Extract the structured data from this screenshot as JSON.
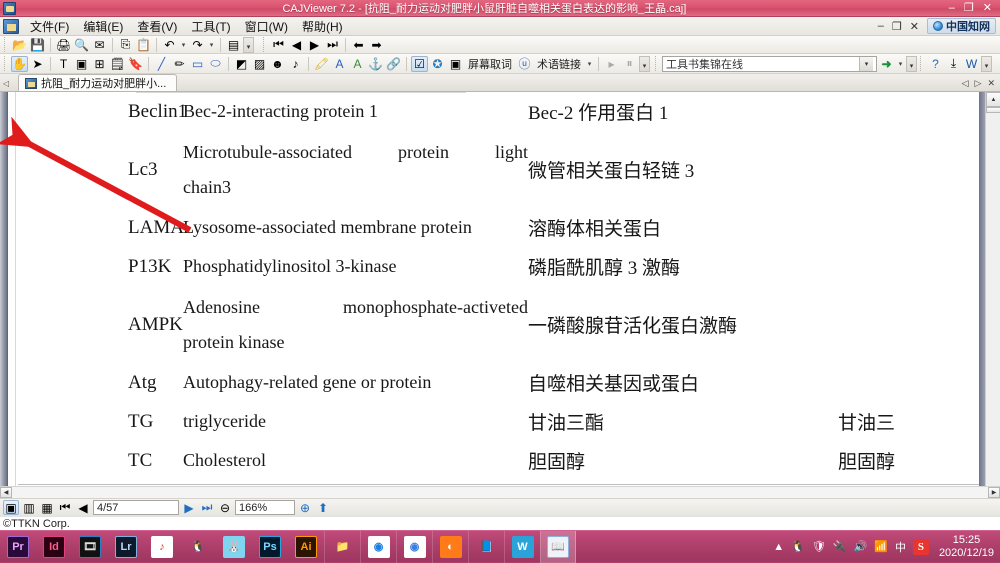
{
  "window": {
    "title": "CAJViewer 7.2 - [抗阻_耐力运动对肥胖小鼠肝脏自噬相关蛋白表达的影响_王晶.caj]",
    "minimize": "–",
    "restore": "❐",
    "close": "✕"
  },
  "menubar": {
    "items": [
      {
        "label": "文件(F)"
      },
      {
        "label": "编辑(E)"
      },
      {
        "label": "查看(V)"
      },
      {
        "label": "工具(T)"
      },
      {
        "label": "窗口(W)"
      },
      {
        "label": "帮助(H)"
      }
    ],
    "doc_minimize": "–",
    "doc_restore": "❐",
    "doc_close": "✕",
    "cnki_label": "中国知网"
  },
  "toolbar_main": {
    "icons": [
      {
        "name": "open-icon",
        "glyph": "📂"
      },
      {
        "name": "save-icon",
        "glyph": "💾"
      },
      {
        "name": "print-icon",
        "glyph": "🖨"
      },
      {
        "name": "print-preview-icon",
        "glyph": "🔍"
      },
      {
        "name": "email-icon",
        "glyph": "✉"
      },
      {
        "name": "copy-icon",
        "glyph": "⎘"
      },
      {
        "name": "paste-icon",
        "glyph": "📋"
      },
      {
        "name": "undo-icon",
        "glyph": "↶"
      },
      {
        "name": "redo-icon",
        "glyph": "↷"
      },
      {
        "name": "page-layout-icon",
        "glyph": "▤"
      }
    ],
    "nav_icons": [
      {
        "name": "first-page-icon",
        "glyph": "⏮"
      },
      {
        "name": "previous-page-icon",
        "glyph": "◀"
      },
      {
        "name": "next-page-icon",
        "glyph": "▶"
      },
      {
        "name": "last-page-icon",
        "glyph": "⏭"
      },
      {
        "name": "go-back-icon",
        "glyph": "⬅"
      },
      {
        "name": "go-forward-icon",
        "glyph": "➡"
      }
    ]
  },
  "toolbar_annot": {
    "icons": [
      {
        "name": "hand-tool-icon",
        "glyph": "✋"
      },
      {
        "name": "select-tool-icon",
        "glyph": "➤"
      },
      {
        "name": "text-select-icon",
        "glyph": "T"
      },
      {
        "name": "image-select-icon",
        "glyph": "▣"
      },
      {
        "name": "table-select-icon",
        "glyph": "⊞"
      },
      {
        "name": "note-icon",
        "glyph": "🗒"
      },
      {
        "name": "stamp-icon",
        "glyph": "🔖"
      },
      {
        "name": "line-icon",
        "glyph": "╱"
      },
      {
        "name": "pencil-icon",
        "glyph": "✏"
      },
      {
        "name": "rectangle-icon",
        "glyph": "▭"
      },
      {
        "name": "ellipse-icon",
        "glyph": "⬭"
      },
      {
        "name": "fill-icon",
        "glyph": "◩"
      },
      {
        "name": "eraser-icon",
        "glyph": "▨"
      },
      {
        "name": "emoji-icon",
        "glyph": "☻"
      },
      {
        "name": "sound-icon",
        "glyph": "♪"
      },
      {
        "name": "highlight-icon",
        "glyph": "🖍"
      },
      {
        "name": "text-annot-icon",
        "glyph": "A"
      },
      {
        "name": "underline-icon",
        "glyph": "A"
      },
      {
        "name": "anchor-icon",
        "glyph": "⚓"
      },
      {
        "name": "link-icon",
        "glyph": "🔗"
      }
    ],
    "screen_capture_word_label": "屏幕取词",
    "term_link_label": "术语链接",
    "reference_combo_value": "工具书集锦在线",
    "go_label": "➜",
    "right_icons": [
      {
        "name": "help-icon",
        "glyph": "?"
      },
      {
        "name": "export-icon",
        "glyph": "⤓"
      },
      {
        "name": "convert-to-word-icon",
        "glyph": "W"
      }
    ]
  },
  "tabstrip": {
    "nav_glyph": "◁",
    "document_tab": "抗阻_耐力运动对肥胖小...",
    "scroll_left": "◁",
    "scroll_right": "▷",
    "close": "✕"
  },
  "document": {
    "rows": [
      {
        "abbr": "Beclin1",
        "english": [
          "Bec-2-interacting protein 1"
        ],
        "justify": false,
        "chinese": "Bec-2 作用蛋白 1",
        "extra": ""
      },
      {
        "abbr": "Lc3",
        "english": [
          "Microtubule-associated|protein|light",
          "chain3"
        ],
        "justify": true,
        "chinese": "微管相关蛋白轻链 3",
        "extra": ""
      },
      {
        "abbr": "LAMA",
        "english": [
          "Lysosome-associated membrane protein"
        ],
        "justify": false,
        "chinese": "溶酶体相关蛋白",
        "extra": ""
      },
      {
        "abbr": "P13K",
        "english": [
          "Phosphatidylinositol 3-kinase"
        ],
        "justify": false,
        "chinese": "磷脂酰肌醇 3 激酶",
        "extra": ""
      },
      {
        "abbr": "AMPK",
        "english": [
          "Adenosine|monophosphate-activeted",
          "protein kinase"
        ],
        "justify": true,
        "chinese": "一磷酸腺苷活化蛋白激酶",
        "extra": ""
      },
      {
        "abbr": "Atg",
        "english": [
          "Autophagy-related gene or protein"
        ],
        "justify": false,
        "chinese": "自噬相关基因或蛋白",
        "extra": ""
      },
      {
        "abbr": "TG",
        "english": [
          "triglyceride"
        ],
        "justify": false,
        "chinese": "甘油三酯",
        "extra": "甘油三"
      },
      {
        "abbr": "TC",
        "english": [
          "Cholesterol"
        ],
        "justify": false,
        "chinese": "胆固醇",
        "extra": "胆固醇"
      }
    ],
    "annotation": {
      "name": "red-arrow",
      "color": "#e01b1b"
    }
  },
  "statusbar": {
    "view_icons": [
      {
        "name": "single-page-icon",
        "glyph": "▣"
      },
      {
        "name": "continuous-page-icon",
        "glyph": "▥"
      },
      {
        "name": "facing-page-icon",
        "glyph": "▦"
      }
    ],
    "first_page": "⏮",
    "prev_page": "◀",
    "page_value": "4/57",
    "next_page": "▶",
    "last_page": "⏭",
    "zoom_out": "⊖",
    "zoom_value": "166%",
    "zoom_in": "⊕",
    "fit_icon": "⬆"
  },
  "copyright": "©TTKN Corp.",
  "taskbar": {
    "apps": [
      {
        "name": "adobe-premiere-icon",
        "label": "Pr",
        "bg": "#2a0a3a",
        "fg": "#e3a6ff",
        "border": "#9b6ad6"
      },
      {
        "name": "adobe-indesign-icon",
        "label": "Id",
        "bg": "#2b0012",
        "fg": "#ff5c8a",
        "border": "#e0417a"
      },
      {
        "name": "video-editor-icon",
        "label": "🎞",
        "bg": "#111111",
        "fg": "#dddddd",
        "border": "#2b7fc4"
      },
      {
        "name": "adobe-lightroom-icon",
        "label": "Lr",
        "bg": "#0d1a2b",
        "fg": "#bcd8f5",
        "border": "#7fb2e0"
      },
      {
        "name": "kugou-music-icon",
        "label": "♪",
        "bg": "#ffffff",
        "fg": "#e03a2f",
        "border": "#ffffff"
      },
      {
        "name": "qq-icon",
        "label": "🐧",
        "bg": "transparent",
        "fg": "#222222",
        "border": "transparent"
      },
      {
        "name": "rabbit-app-icon",
        "label": "🐰",
        "bg": "#7fd4f0",
        "fg": "#ffffff",
        "border": "#7fd4f0"
      },
      {
        "name": "adobe-photoshop-icon",
        "label": "Ps",
        "bg": "#001a2b",
        "fg": "#7fd4ff",
        "border": "#2aa3e0"
      },
      {
        "name": "adobe-illustrator-icon",
        "label": "Ai",
        "bg": "#2b1400",
        "fg": "#ff9a00",
        "border": "#ff9a00"
      },
      {
        "name": "file-explorer-icon",
        "label": "📁",
        "bg": "transparent",
        "fg": "#f0d27a",
        "border": "transparent"
      },
      {
        "name": "qq-browser-icon",
        "label": "◉",
        "bg": "#ffffff",
        "fg": "#1b7fe0",
        "border": "#ffffff"
      },
      {
        "name": "google-chrome-icon",
        "label": "◉",
        "bg": "#ffffff",
        "fg": "#3b7de0",
        "border": "#ffffff"
      },
      {
        "name": "firefox-icon",
        "label": "◐",
        "bg": "#ff7a18",
        "fg": "#ffffff",
        "border": "#ff7a18"
      },
      {
        "name": "notepad-icon",
        "label": "📘",
        "bg": "transparent",
        "fg": "#dcecf8",
        "border": "transparent"
      },
      {
        "name": "wps-office-icon",
        "label": "W",
        "bg": "#2aa3d8",
        "fg": "#ffffff",
        "border": "#2aa3d8"
      },
      {
        "name": "cajviewer-taskbar-icon",
        "label": "📖",
        "bg": "#eef3fb",
        "fg": "#2a5fa8",
        "border": "#8fb0d8"
      }
    ],
    "tray": {
      "expand": "▲",
      "icons": [
        {
          "name": "qq-tray-icon",
          "glyph": "🐧"
        },
        {
          "name": "security-tray-icon",
          "glyph": "🛡"
        },
        {
          "name": "usb-device-icon",
          "glyph": "🔌"
        },
        {
          "name": "volume-icon",
          "glyph": "🔊"
        },
        {
          "name": "network-icon",
          "glyph": "📶"
        },
        {
          "name": "ime-icon",
          "glyph": "中"
        }
      ],
      "sogou_label": "S",
      "time": "15:25",
      "date": "2020/12/19"
    }
  }
}
